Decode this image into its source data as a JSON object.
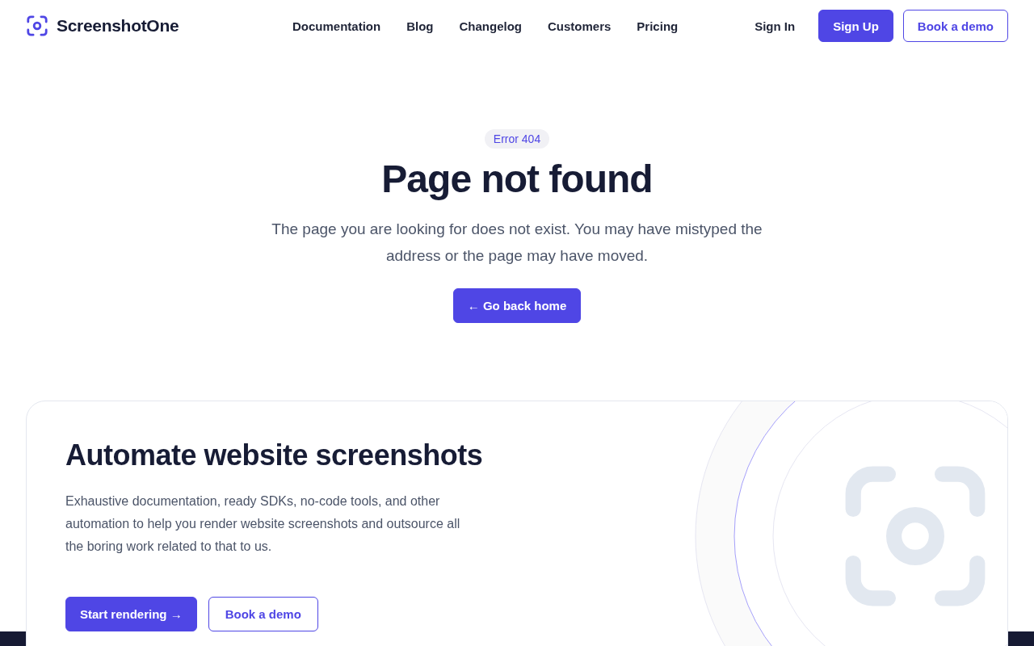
{
  "header": {
    "brand": "ScreenshotOne",
    "nav": [
      "Documentation",
      "Blog",
      "Changelog",
      "Customers",
      "Pricing"
    ],
    "sign_in": "Sign In",
    "sign_up": "Sign Up",
    "demo": "Book a demo"
  },
  "error": {
    "badge": "Error 404",
    "title": "Page not found",
    "message": "The page you are looking for does not exist. You may have mistyped the address or the page may have moved.",
    "button": "← Go back home"
  },
  "promo": {
    "title": "Automate website screenshots",
    "text": "Exhaustive documentation, ready SDKs, no-code tools, and other automation to help you render website screenshots and outsource all the boring work related to that to us.",
    "primary": "Start rendering →",
    "secondary": "Book a demo"
  }
}
